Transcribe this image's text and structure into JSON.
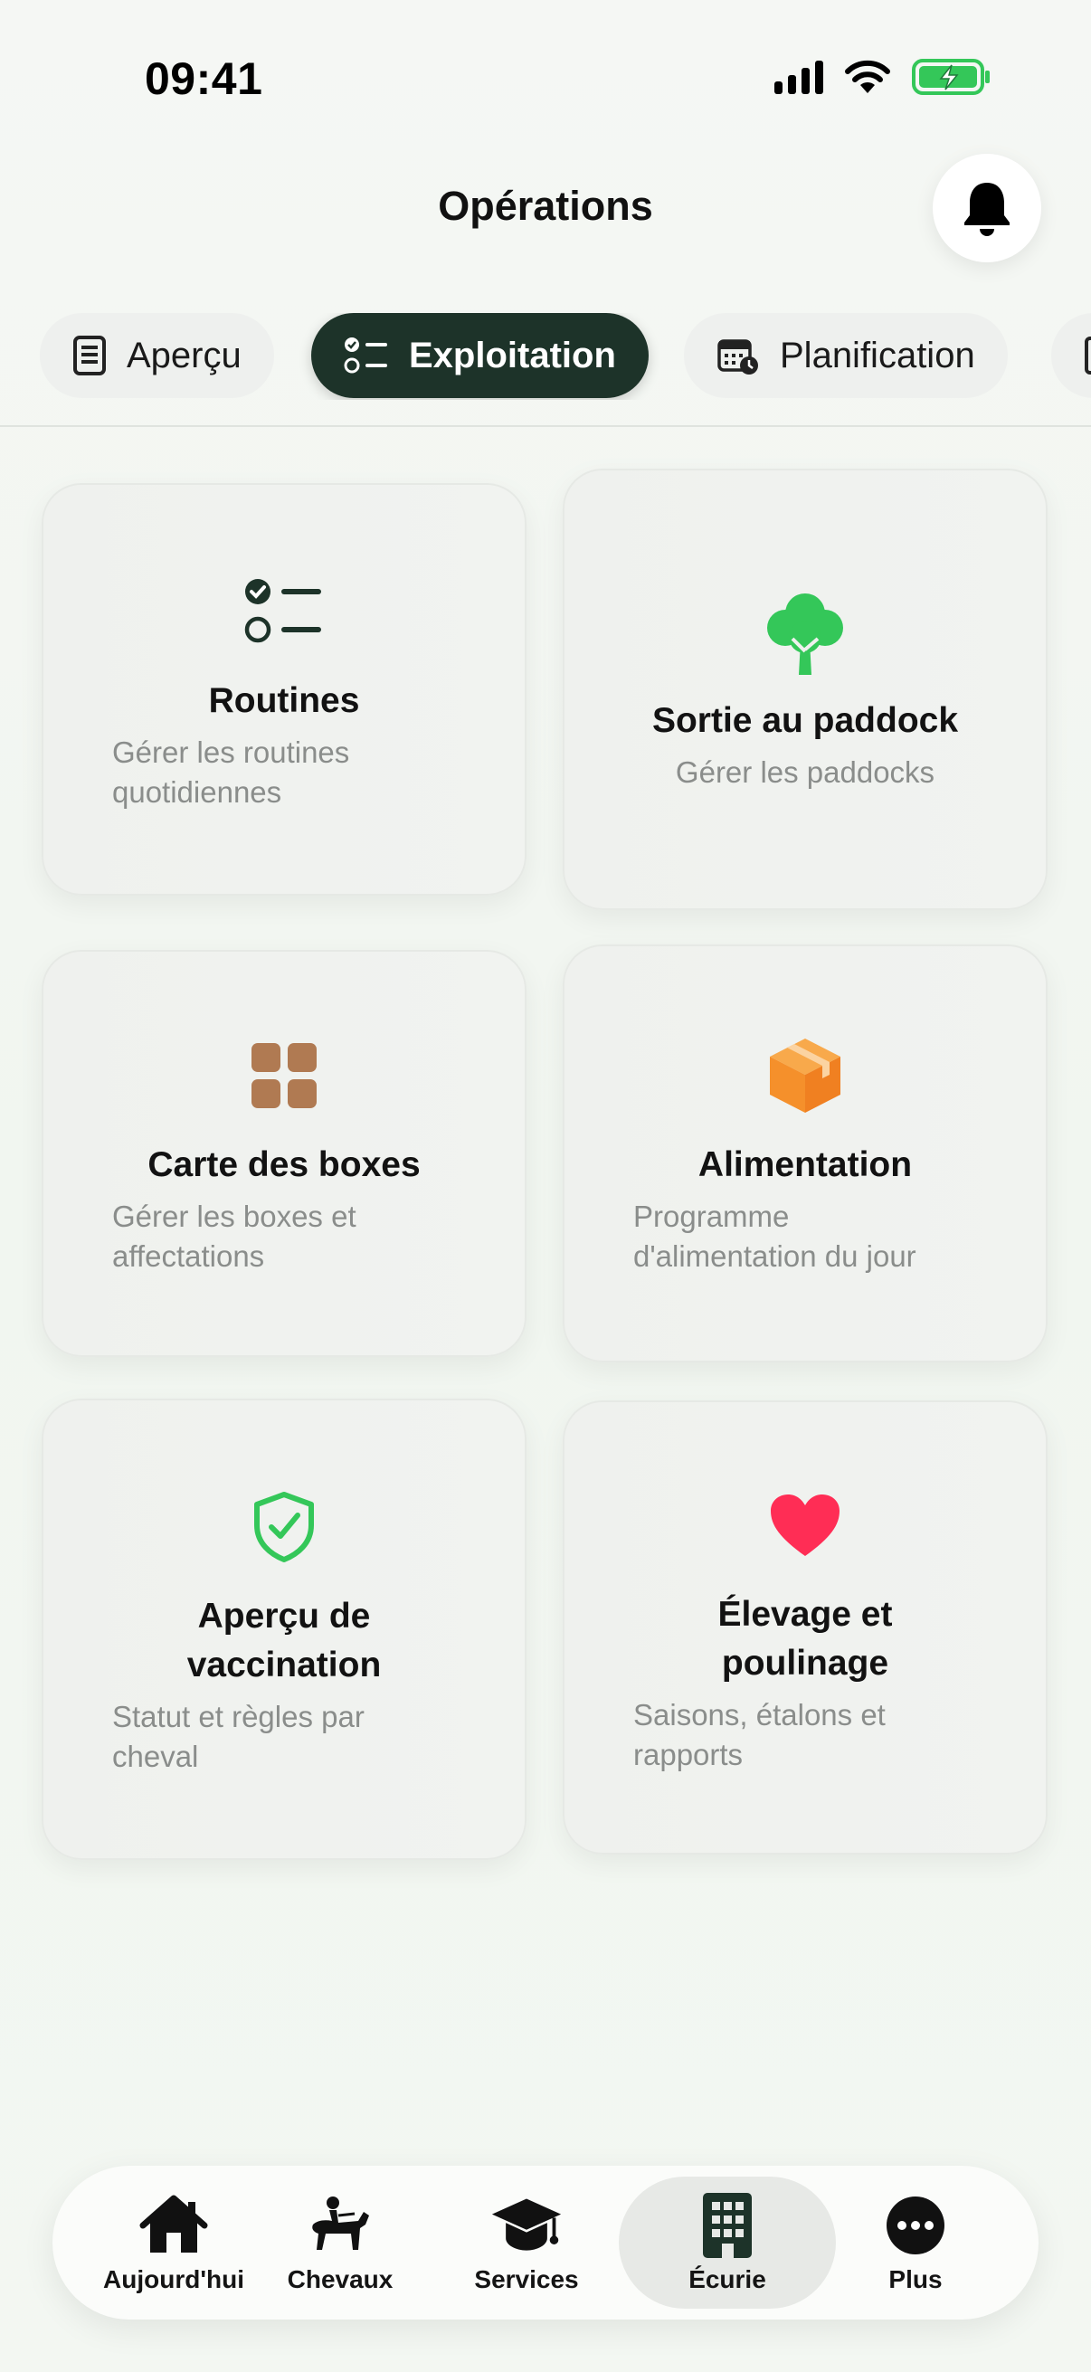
{
  "status_bar": {
    "time": "09:41"
  },
  "header": {
    "title": "Opérations"
  },
  "tabs": [
    {
      "label": "Aperçu",
      "icon": "document-icon",
      "active": false
    },
    {
      "label": "Exploitation",
      "icon": "checklist-icon",
      "active": true
    },
    {
      "label": "Planification",
      "icon": "calendar-clock-icon",
      "active": false
    }
  ],
  "cards": [
    {
      "title": "Routines",
      "description": "Gérer les routines quotidiennes",
      "icon": "checklist-icon",
      "color": "#1d3329"
    },
    {
      "title": "Sortie au paddock",
      "description": "Gérer les paddocks",
      "icon": "tree-icon",
      "color": "#34c759"
    },
    {
      "title": "Carte des boxes",
      "description": "Gérer les boxes et affectations",
      "icon": "grid-icon",
      "color": "#b07a52"
    },
    {
      "title": "Alimentation",
      "description": "Programme d'alimentation du jour",
      "icon": "box-icon",
      "color": "#f5902b"
    },
    {
      "title": "Aperçu de vaccination",
      "description": "Statut et règles par cheval",
      "icon": "shield-check-icon",
      "color": "#34c759"
    },
    {
      "title": "Élevage et poulinage",
      "description": "Saisons, étalons et rapports",
      "icon": "heart-icon",
      "color": "#ff2d55"
    }
  ],
  "bottom_nav": [
    {
      "label": "Aujourd'hui",
      "icon": "house-icon",
      "active": false
    },
    {
      "label": "Chevaux",
      "icon": "horse-rider-icon",
      "active": false
    },
    {
      "label": "Services",
      "icon": "graduation-cap-icon",
      "active": false
    },
    {
      "label": "Écurie",
      "icon": "building-icon",
      "active": true
    },
    {
      "label": "Plus",
      "icon": "more-icon",
      "active": false
    }
  ]
}
